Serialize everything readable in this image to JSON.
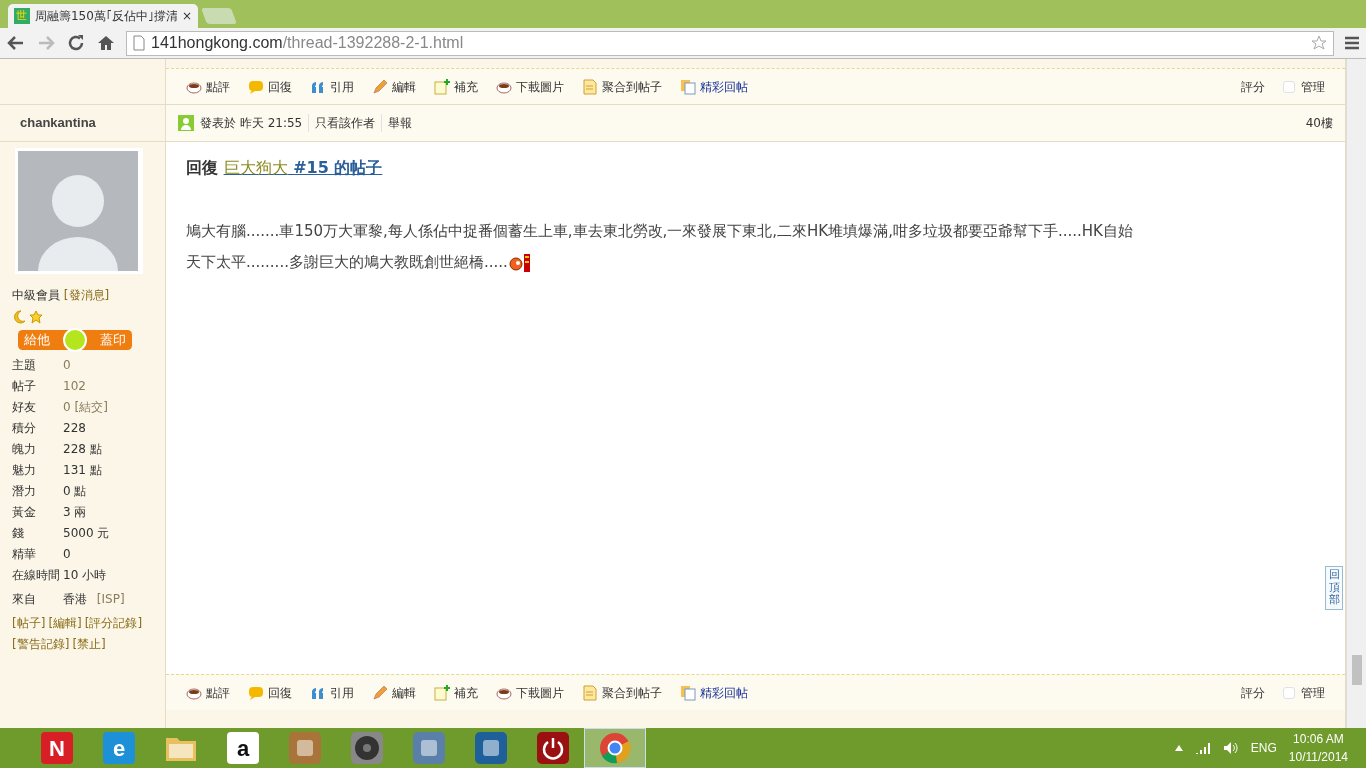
{
  "browser": {
    "favicon_glyph": "世",
    "tab_title": "周融籌150萬｢反佔中｣撐清",
    "close_glyph": "×",
    "url_host": "141hongkong.com",
    "url_path": "/thread-1392288-2-1.html",
    "forward_disabled": true
  },
  "actions_top": {
    "items": [
      {
        "label": "點評",
        "kind": "cup",
        "highlight": false
      },
      {
        "label": "回復",
        "kind": "bubble",
        "highlight": false
      },
      {
        "label": "引用",
        "kind": "quote",
        "highlight": false
      },
      {
        "label": "編輯",
        "kind": "pencil",
        "highlight": false
      },
      {
        "label": "補充",
        "kind": "note",
        "highlight": false
      },
      {
        "label": "下載圖片",
        "kind": "cup",
        "highlight": false
      },
      {
        "label": "聚合到帖子",
        "kind": "doc",
        "highlight": false
      },
      {
        "label": "精彩回帖",
        "kind": "docs",
        "highlight": true
      }
    ],
    "rate": "評分",
    "manage": {
      "label": "管理",
      "checked": false
    }
  },
  "author": {
    "name": "chankantina",
    "rank": "中級會員",
    "pm_link": "[發消息]",
    "stamp_left": "給他",
    "stamp_right": "蓋印",
    "stats": [
      {
        "label": "主題",
        "value": "0",
        "linked": true
      },
      {
        "label": "帖子",
        "value": "102",
        "linked": true
      },
      {
        "label": "好友",
        "value": "0",
        "linked": true,
        "action": "[結交]"
      },
      {
        "label": "積分",
        "value": "228",
        "linked": false
      },
      {
        "label": "魄力",
        "value": "228 點",
        "linked": false
      },
      {
        "label": "魅力",
        "value": "131 點",
        "linked": false
      },
      {
        "label": "潛力",
        "value": "0 點",
        "linked": false
      },
      {
        "label": "黃金",
        "value": "3 兩",
        "linked": false
      },
      {
        "label": "錢",
        "value": "5000 元",
        "linked": false
      },
      {
        "label": "精華",
        "value": "0",
        "linked": false
      },
      {
        "label": "在線時間",
        "value": "10 小時",
        "linked": false
      }
    ],
    "from": {
      "label": "來自",
      "value": "香港",
      "action": "[ISP]"
    },
    "link_rows": [
      [
        "[帖子]",
        "[編輯]",
        "[評分記錄]"
      ],
      [
        "[警告記錄]",
        "[禁止]"
      ]
    ]
  },
  "post": {
    "posted": "發表於 昨天 21:55",
    "only_author": "只看該作者",
    "report": "舉報",
    "floor": "40樓",
    "reply_prefix": "回復",
    "reply_user": "巨大狗大",
    "reply_ref": "#15 的帖子",
    "body_lines": [
      "鳩大有腦.......車150万大軍黎,每人係佔中捉番個蓄生上車,車去東北勞改,一來發展下東北,二來HK堆填爆滿,咁多垃圾都要亞爺幫下手.....HK自始",
      "天下太平.........多謝巨大的鳩大教既創世絕橋....."
    ]
  },
  "back_to_top": "回頂部",
  "actions_bottom": {
    "items": [
      {
        "label": "點評",
        "kind": "cup",
        "highlight": false
      },
      {
        "label": "回復",
        "kind": "bubble",
        "highlight": false
      },
      {
        "label": "引用",
        "kind": "quote",
        "highlight": false
      },
      {
        "label": "編輯",
        "kind": "pencil",
        "highlight": false
      },
      {
        "label": "補充",
        "kind": "note",
        "highlight": false
      },
      {
        "label": "下載圖片",
        "kind": "cup",
        "highlight": false
      },
      {
        "label": "聚合到帖子",
        "kind": "doc",
        "highlight": false
      },
      {
        "label": "精彩回帖",
        "kind": "docs",
        "highlight": true
      }
    ],
    "rate": "評分",
    "manage": {
      "label": "管理",
      "checked": false
    }
  },
  "taskbar": {
    "apps": [
      {
        "kind": "letter",
        "glyph": "N",
        "selected": false
      },
      {
        "kind": "letter",
        "glyph": "e",
        "selected": false
      },
      {
        "kind": "folder",
        "selected": false
      },
      {
        "kind": "letter",
        "glyph": "a",
        "selected": false
      },
      {
        "kind": "square",
        "selected": false
      },
      {
        "kind": "circle",
        "selected": false
      },
      {
        "kind": "square",
        "selected": false
      },
      {
        "kind": "square",
        "selected": false
      },
      {
        "kind": "power",
        "selected": false
      },
      {
        "kind": "chrome",
        "selected": true
      }
    ],
    "lang": "ENG",
    "time": "10:06 AM",
    "date": "10/11/2014"
  }
}
